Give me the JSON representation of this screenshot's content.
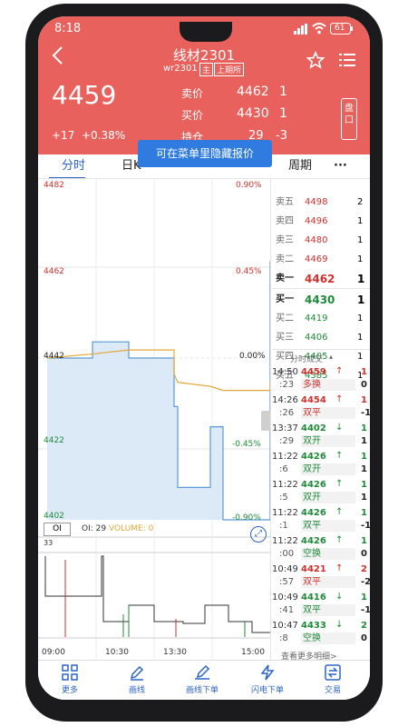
{
  "status": {
    "time": "8:18",
    "battery": "61"
  },
  "header": {
    "title": "线材2301",
    "code": "wr2301",
    "tag_main": "主",
    "tag_exchange": "上期所",
    "price": "4459",
    "change": "+17",
    "change_pct": "+0.38%",
    "ask_label": "卖价",
    "ask_price": "4462",
    "ask_vol": "1",
    "bid_label": "买价",
    "bid_price": "4430",
    "bid_vol": "1",
    "hold_label": "持仓",
    "hold_val": "29",
    "hold_chg": "-3",
    "side_label": "盘口"
  },
  "tooltip": "可在菜单里隐藏报价",
  "tabs": {
    "fenshi": "分时",
    "rik": "日K",
    "zhouqi": "周期",
    "more": "···"
  },
  "chart": {
    "y_left": [
      "4482",
      "4462",
      "4442",
      "4422",
      "4402"
    ],
    "y_right": [
      "0.90%",
      "0.45%",
      "0.00%",
      "-0.45%",
      "-0.90%"
    ],
    "oi_btn": "OI",
    "oi_label": "OI: 29",
    "volume_label": "VOLUME: 0",
    "vol_max": "33",
    "x_labels": [
      "09:00",
      "10:30",
      "13:30",
      "15:00"
    ]
  },
  "chart_data": {
    "type": "line",
    "title": "",
    "x": [
      "09:00",
      "10:30",
      "13:30",
      "15:00"
    ],
    "ylim": [
      4402,
      4482
    ],
    "series": [
      {
        "values": [
          4442,
          4446,
          4442,
          4442,
          4430,
          4410,
          4425,
          4402,
          4402,
          4462,
          4466
        ]
      },
      {
        "values": [
          4442,
          4443,
          4444,
          4444,
          4438,
          4436,
          4435,
          4434,
          4434,
          4434,
          4436
        ]
      }
    ]
  },
  "orderbook": {
    "asks": [
      {
        "label": "卖五",
        "price": "4498",
        "vol": "2"
      },
      {
        "label": "卖四",
        "price": "4496",
        "vol": "1"
      },
      {
        "label": "卖三",
        "price": "4480",
        "vol": "1"
      },
      {
        "label": "卖二",
        "price": "4469",
        "vol": "1"
      },
      {
        "label": "卖一",
        "price": "4462",
        "vol": "1"
      }
    ],
    "bids": [
      {
        "label": "买一",
        "price": "4430",
        "vol": "1"
      },
      {
        "label": "买二",
        "price": "4419",
        "vol": "1"
      },
      {
        "label": "买三",
        "price": "4406",
        "vol": "1"
      },
      {
        "label": "买四",
        "price": "4405",
        "vol": "1"
      },
      {
        "label": "买五",
        "price": "4385",
        "vol": "1"
      }
    ]
  },
  "trades": {
    "title": "分时成交",
    "rows": [
      {
        "time": "14:50",
        "sec": ":23",
        "price": "4459",
        "arrow": "↑",
        "vol": "1",
        "type": "多换",
        "chg": "0",
        "color": "#d0302b"
      },
      {
        "time": "14:26",
        "sec": ":26",
        "price": "4454",
        "arrow": "↑",
        "vol": "1",
        "type": "双平",
        "chg": "-1",
        "color": "#d0302b"
      },
      {
        "time": "13:37",
        "sec": ":29",
        "price": "4402",
        "arrow": "↓",
        "vol": "1",
        "type": "双开",
        "chg": "1",
        "color": "#1f8a3a"
      },
      {
        "time": "11:22",
        "sec": ":6",
        "price": "4426",
        "arrow": "↑",
        "vol": "1",
        "type": "双开",
        "chg": "1",
        "color": "#1f8a3a"
      },
      {
        "time": "11:22",
        "sec": ":5",
        "price": "4426",
        "arrow": "↑",
        "vol": "1",
        "type": "双开",
        "chg": "1",
        "color": "#1f8a3a"
      },
      {
        "time": "11:22",
        "sec": ":1",
        "price": "4426",
        "arrow": "↑",
        "vol": "1",
        "type": "双平",
        "chg": "-1",
        "color": "#1f8a3a"
      },
      {
        "time": "11:22",
        "sec": ":00",
        "price": "4426",
        "arrow": "↑",
        "vol": "1",
        "type": "空换",
        "chg": "0",
        "color": "#1f8a3a"
      },
      {
        "time": "10:49",
        "sec": ":57",
        "price": "4421",
        "arrow": "↑",
        "vol": "2",
        "type": "双平",
        "chg": "-2",
        "color": "#d0302b"
      },
      {
        "time": "10:49",
        "sec": ":41",
        "price": "4416",
        "arrow": "↓",
        "vol": "1",
        "type": "双平",
        "chg": "-1",
        "color": "#1f8a3a"
      },
      {
        "time": "10:47",
        "sec": ":8",
        "price": "4433",
        "arrow": "↓",
        "vol": "2",
        "type": "空换",
        "chg": "0",
        "color": "#1f8a3a"
      }
    ],
    "more": "查看更多明细>"
  },
  "toolbar": {
    "more": "更多",
    "draw": "画线",
    "draw_order": "画线下单",
    "flash_order": "闪电下单",
    "trade": "交易"
  },
  "colors": {
    "header": "#e8615c",
    "up": "#d0302b",
    "down": "#1f8a3a",
    "accent": "#2b63c6"
  }
}
